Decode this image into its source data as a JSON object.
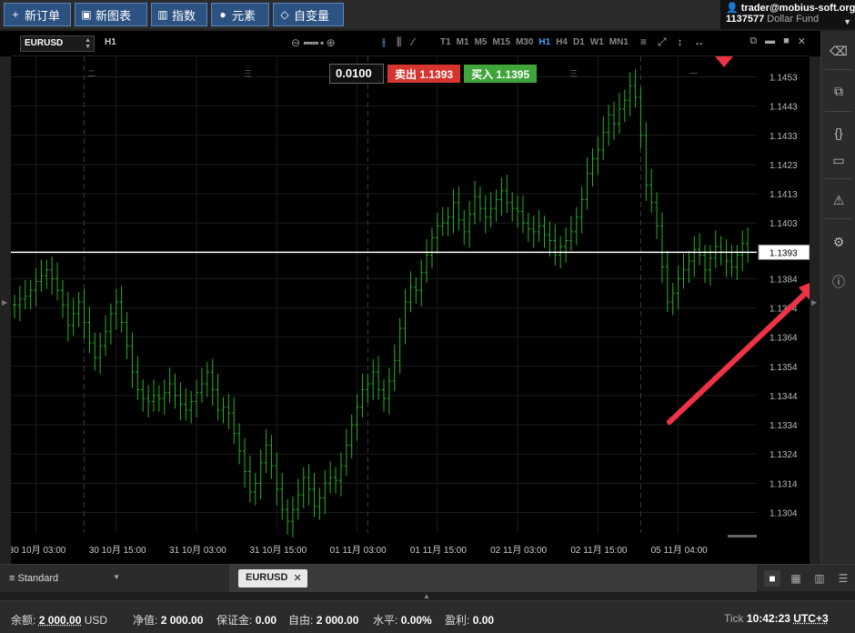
{
  "toolbar": {
    "buttons": [
      {
        "icon": "plus-icon",
        "label": "新订单"
      },
      {
        "icon": "chart-icon",
        "label": "新图表"
      },
      {
        "icon": "bar-chart-icon",
        "label": "指数"
      },
      {
        "icon": "shapes-icon",
        "label": "元素"
      },
      {
        "icon": "diamond-icon",
        "label": "自变量"
      }
    ]
  },
  "account": {
    "user": "trader@mobius-soft.org",
    "number": "1137577",
    "fund": "Dollar Fund"
  },
  "chart_header": {
    "symbol": "EURUSD",
    "timeframe": "H1",
    "timeframes": [
      "T1",
      "M1",
      "M5",
      "M15",
      "M30",
      "H1",
      "H4",
      "D1",
      "W1",
      "MN1"
    ],
    "active_timeframe": "H1"
  },
  "trade_panel": {
    "lot": "0.0100",
    "sell_label": "卖出",
    "sell_price": "1.1393",
    "buy_label": "买入",
    "buy_price": "1.1395"
  },
  "chart_data": {
    "type": "ohlc",
    "symbol": "EURUSD",
    "timeframe": "H1",
    "current_price": 1.1393,
    "ylim": [
      1.1297,
      1.146
    ],
    "y_ticks": [
      "1.1453",
      "1.1443",
      "1.1433",
      "1.1423",
      "1.1413",
      "1.1403",
      "1.1393",
      "1.1384",
      "1.1374",
      "1.1364",
      "1.1354",
      "1.1344",
      "1.1334",
      "1.1324",
      "1.1314",
      "1.1304"
    ],
    "x_ticks": [
      "30 10月 03:00",
      "30 10月 15:00",
      "31 10月 03:00",
      "31 10月 15:00",
      "01 11月 03:00",
      "01 11月 15:00",
      "02 11月 03:00",
      "02 11月 15:00",
      "05 11月 04:00"
    ],
    "closes": [
      1.1375,
      1.1377,
      1.1378,
      1.138,
      1.1383,
      1.1385,
      1.1387,
      1.1384,
      1.138,
      1.1375,
      1.1368,
      1.1372,
      1.1376,
      1.1369,
      1.1362,
      1.1357,
      1.1361,
      1.1366,
      1.1372,
      1.1376,
      1.1369,
      1.1361,
      1.1352,
      1.1346,
      1.1343,
      1.1342,
      1.1344,
      1.1343,
      1.1345,
      1.1348,
      1.1344,
      1.1341,
      1.1339,
      1.1342,
      1.1345,
      1.1348,
      1.1352,
      1.1346,
      1.1339,
      1.134,
      1.1338,
      1.1331,
      1.1325,
      1.1318,
      1.1311,
      1.1314,
      1.1321,
      1.1327,
      1.132,
      1.1312,
      1.1305,
      1.1301,
      1.1305,
      1.131,
      1.1316,
      1.1312,
      1.1306,
      1.1309,
      1.1314,
      1.1316,
      1.1315,
      1.132,
      1.1327,
      1.1334,
      1.134,
      1.1346,
      1.1348,
      1.1352,
      1.1346,
      1.1343,
      1.1349,
      1.1356,
      1.1367,
      1.1376,
      1.1381,
      1.138,
      1.1386,
      1.1392,
      1.1398,
      1.1402,
      1.1403,
      1.1405,
      1.141,
      1.1404,
      1.14,
      1.1406,
      1.1412,
      1.1408,
      1.1405,
      1.1408,
      1.1411,
      1.1414,
      1.141,
      1.1408,
      1.1407,
      1.1403,
      1.1401,
      1.14,
      1.1402,
      1.1399,
      1.1397,
      1.1392,
      1.1395,
      1.1397,
      1.14,
      1.1405,
      1.1411,
      1.142,
      1.1425,
      1.1428,
      1.1434,
      1.144,
      1.1437,
      1.1442,
      1.1445,
      1.145,
      1.1446,
      1.1433,
      1.1416,
      1.141,
      1.1402,
      1.1388,
      1.1376,
      1.1379,
      1.1384,
      1.1387,
      1.139,
      1.1394,
      1.1392,
      1.1387,
      1.1391,
      1.1395,
      1.1393,
      1.139,
      1.1388,
      1.1392,
      1.1396,
      1.1393
    ]
  },
  "sidebar": {
    "icons": [
      "eraser-icon",
      "copy-icon",
      "code-icon",
      "terminal-icon",
      "warning-icon",
      "gear-icon",
      "info-icon"
    ]
  },
  "bottom_tabs": {
    "workspace": "Standard",
    "open_tab": "EURUSD"
  },
  "status": {
    "balance_label": "余额:",
    "balance_value": "2 000.00",
    "balance_currency": "USD",
    "equity_label": "净值:",
    "equity_value": "2 000.00",
    "margin_label": "保证金:",
    "margin_value": "0.00",
    "free_label": "自由:",
    "free_value": "2 000.00",
    "level_label": "水平:",
    "level_value": "0.00%",
    "pnl_label": "盈利:",
    "pnl_value": "0.00",
    "tick_label": "Tick",
    "time": "10:42:23",
    "timezone": "UTC+3"
  },
  "colors": {
    "up_bar": "#22b422",
    "price_line": "#ffffff",
    "arrow": "#ee3344",
    "sell": "#d5352e",
    "buy": "#3fa53a"
  }
}
